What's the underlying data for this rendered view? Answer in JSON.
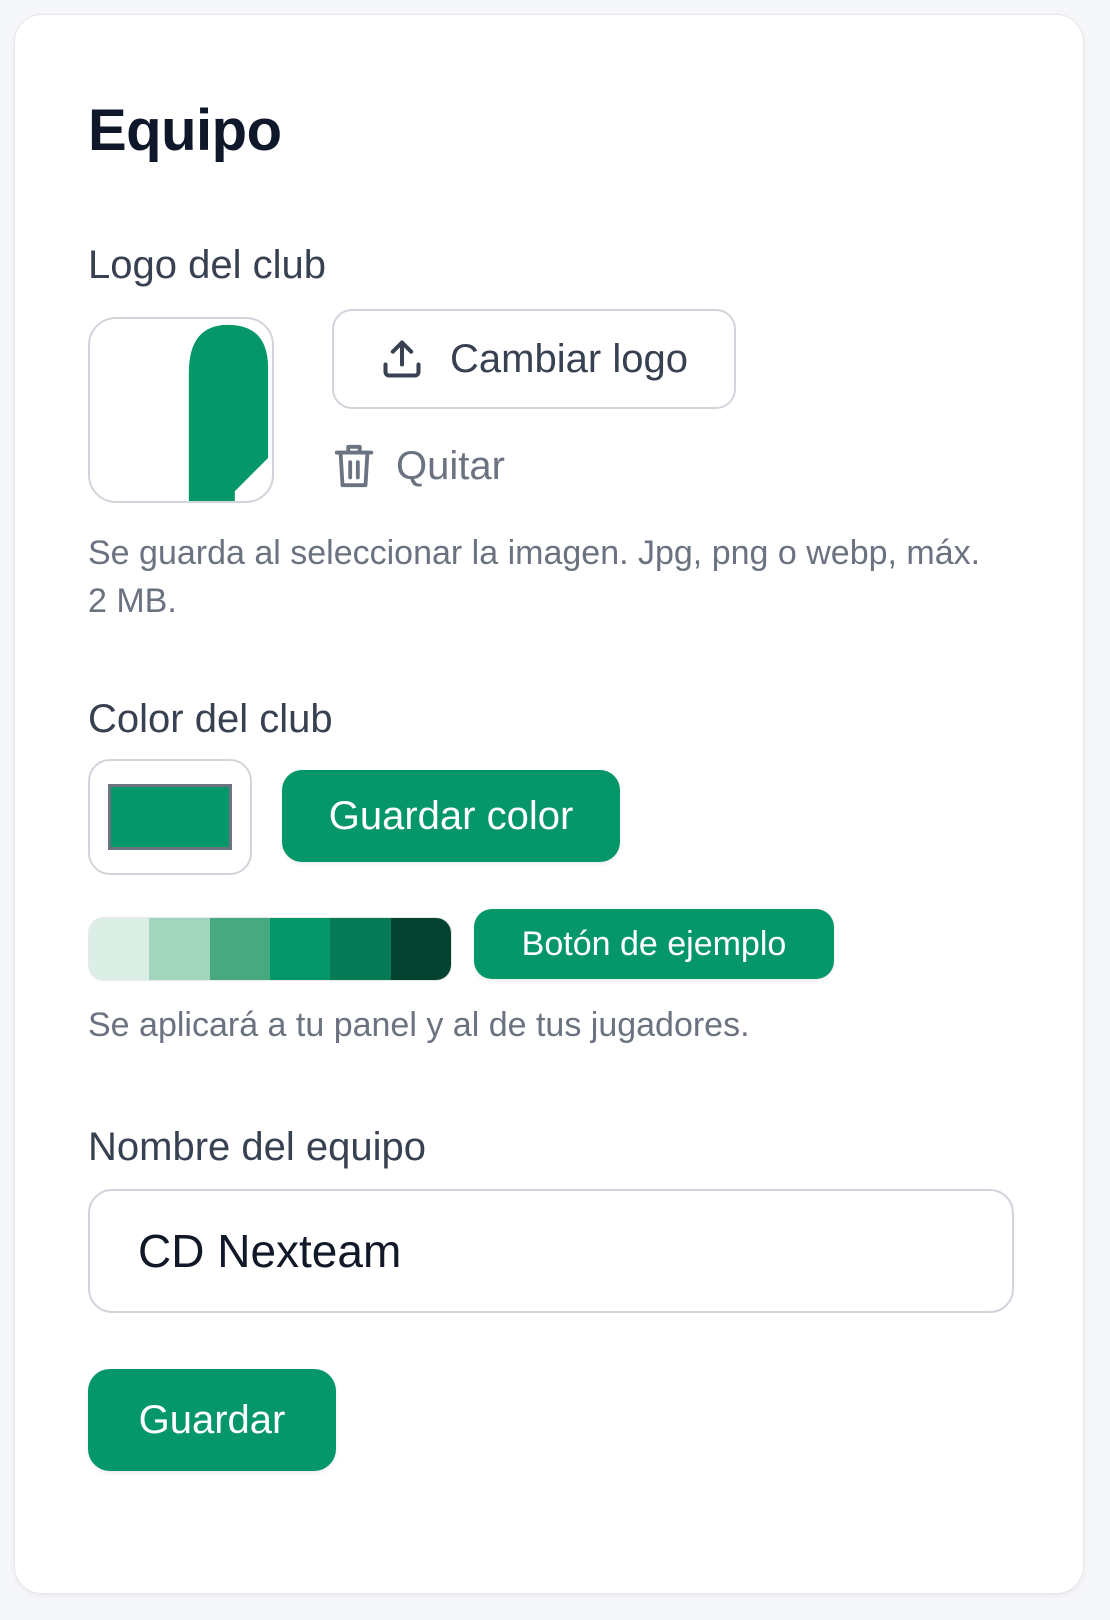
{
  "team": {
    "title": "Equipo",
    "logo": {
      "label": "Logo del club",
      "change_label": "Cambiar logo",
      "remove_label": "Quitar",
      "hint": "Se guarda al seleccionar la imagen. Jpg, png o webp, máx. 2 MB."
    },
    "color": {
      "label": "Color del club",
      "value": "#059669",
      "save_label": "Guardar color",
      "palette": [
        "#dcefe6",
        "#a3d4bd",
        "#48a981",
        "#059669",
        "#057a55",
        "#04432f"
      ],
      "example_label": "Botón de ejemplo",
      "hint": "Se aplicará a tu panel y al de tus jugadores."
    },
    "name": {
      "label": "Nombre del equipo",
      "value": "CD Nexteam"
    },
    "save_label": "Guardar"
  },
  "colors": {
    "accent": "#059669",
    "text_primary": "#0f172a",
    "text_secondary": "#374151",
    "text_muted": "#6b7280",
    "border": "#d1d5db"
  },
  "icons": {
    "upload": "upload-icon",
    "trash": "trash-icon"
  }
}
